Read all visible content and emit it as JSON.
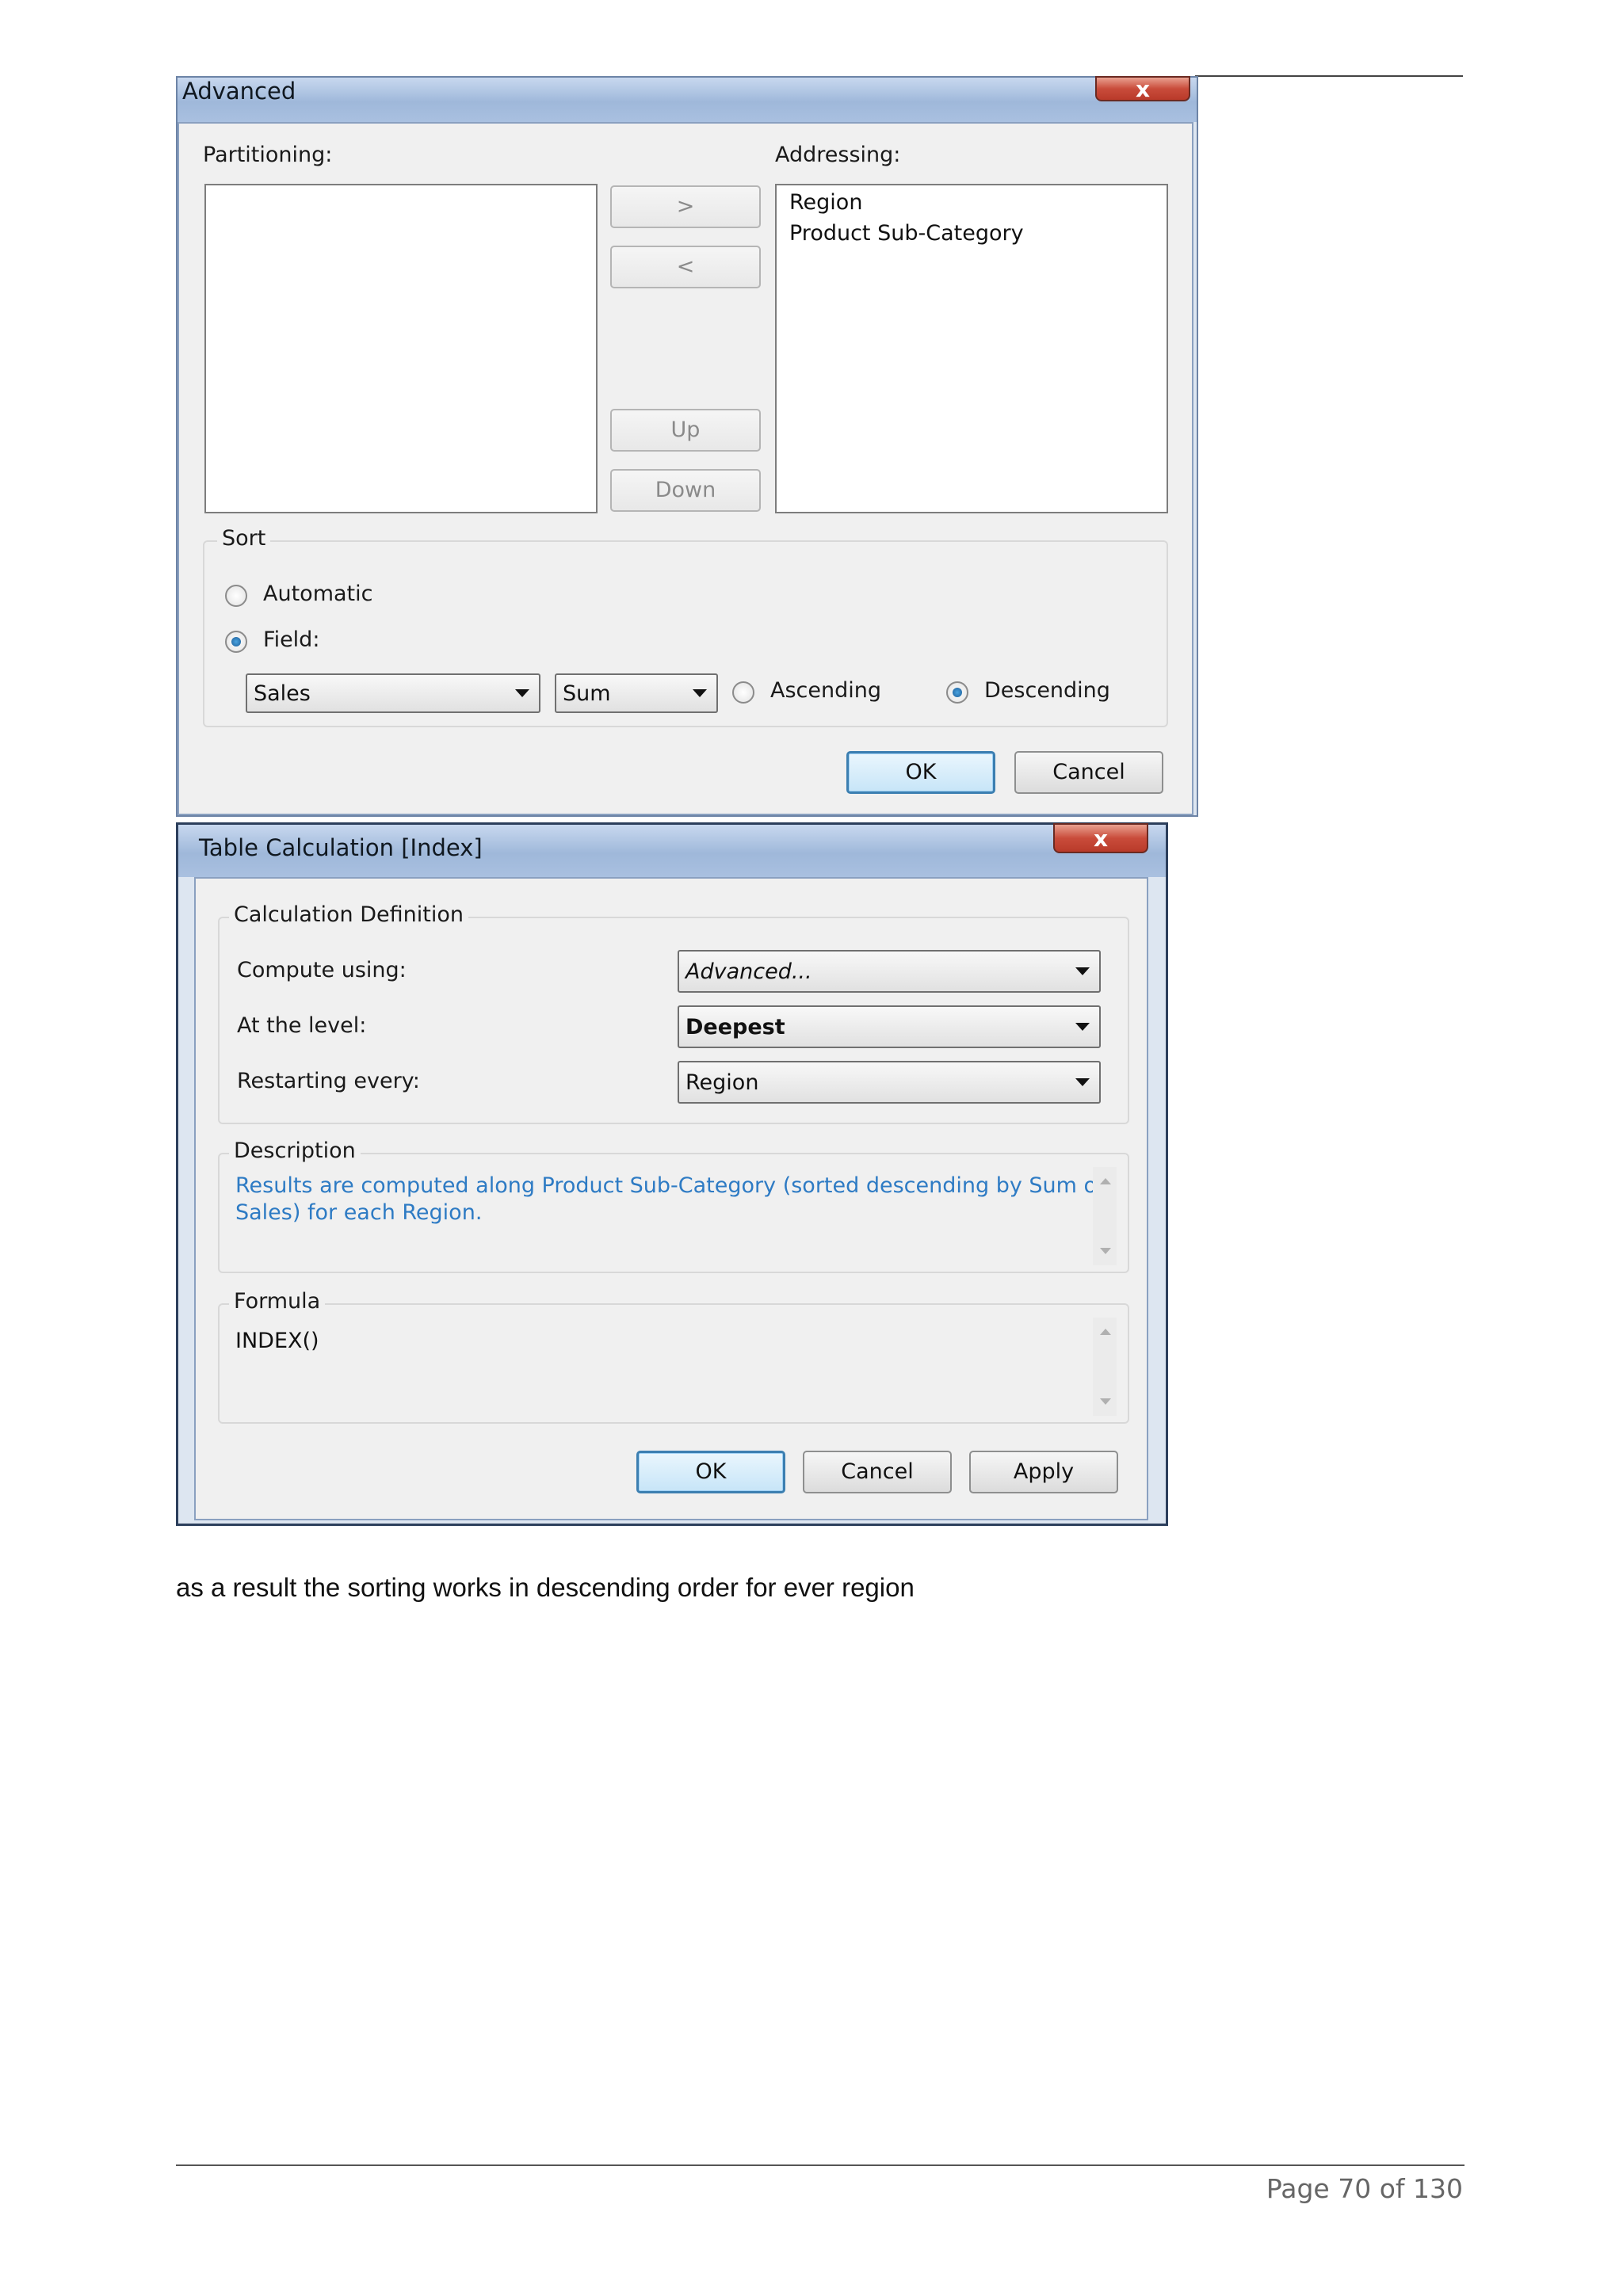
{
  "advanced_dialog": {
    "title": "Advanced",
    "close_label": "x",
    "partitioning_label": "Partitioning:",
    "addressing_label": "Addressing:",
    "addressing_items": [
      "Region",
      "Product Sub-Category"
    ],
    "move_right_label": ">",
    "move_left_label": "<",
    "up_label": "Up",
    "down_label": "Down",
    "sort": {
      "legend": "Sort",
      "automatic_label": "Automatic",
      "field_label": "Field:",
      "selected": "Field",
      "field_value": "Sales",
      "aggregation_value": "Sum",
      "ascending_label": "Ascending",
      "descending_label": "Descending",
      "order": "Descending"
    },
    "ok_label": "OK",
    "cancel_label": "Cancel"
  },
  "table_calc_dialog": {
    "title": "Table Calculation [Index]",
    "close_label": "x",
    "calc_definition": {
      "legend": "Calculation Definition",
      "compute_using_label": "Compute using:",
      "compute_using_value": "Advanced...",
      "at_level_label": "At the level:",
      "at_level_value": "Deepest",
      "restarting_label": "Restarting every:",
      "restarting_value": "Region"
    },
    "description": {
      "legend": "Description",
      "line1": "Results are computed along Product Sub-Category (sorted descending by Sum of",
      "line2": "Sales) for each Region."
    },
    "formula": {
      "legend": "Formula",
      "text": "INDEX()"
    },
    "ok_label": "OK",
    "cancel_label": "Cancel",
    "apply_label": "Apply"
  },
  "body_text": "as a result the sorting works in descending order for ever region",
  "footer": {
    "page_label": "Page 70 of 130"
  },
  "colors": {
    "title_gradient": "#9fb8da",
    "close_red": "#c94c3b",
    "description_blue": "#2e7bc4",
    "default_button_border": "#3c7fb1"
  }
}
